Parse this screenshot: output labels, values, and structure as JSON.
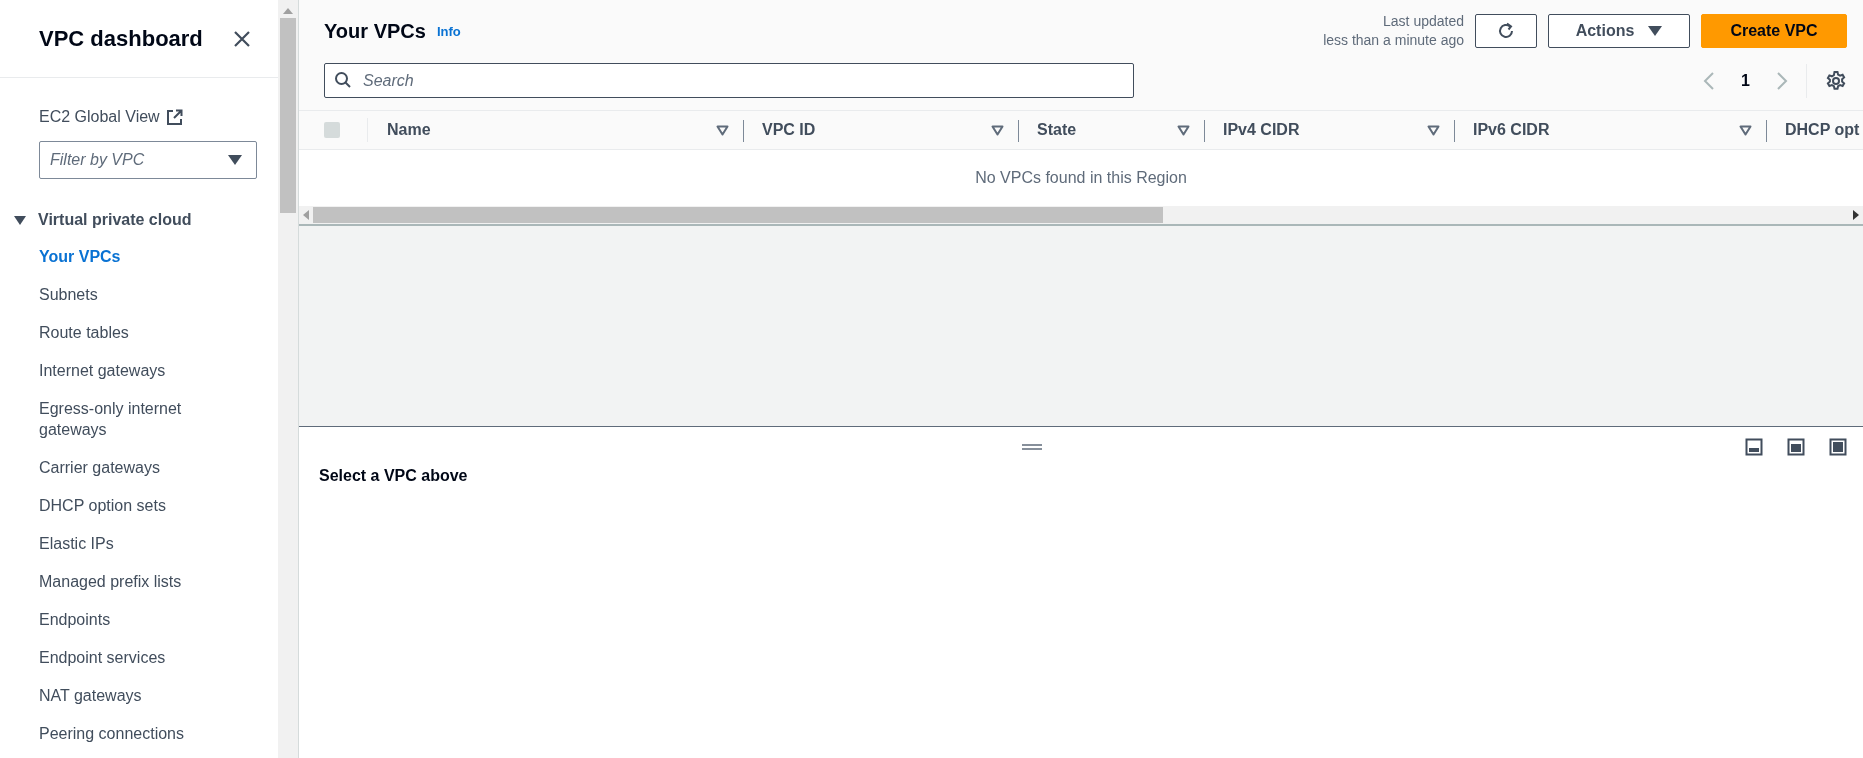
{
  "sidebar": {
    "title": "VPC dashboard",
    "global_view_link": "EC2 Global View",
    "filter": {
      "placeholder": "Filter by VPC"
    },
    "section": {
      "label": "Virtual private cloud",
      "expanded": true,
      "items": [
        {
          "label": "Your VPCs",
          "selected": true
        },
        {
          "label": "Subnets",
          "selected": false
        },
        {
          "label": "Route tables",
          "selected": false
        },
        {
          "label": "Internet gateways",
          "selected": false
        },
        {
          "label": "Egress-only internet gateways",
          "selected": false
        },
        {
          "label": "Carrier gateways",
          "selected": false
        },
        {
          "label": "DHCP option sets",
          "selected": false
        },
        {
          "label": "Elastic IPs",
          "selected": false
        },
        {
          "label": "Managed prefix lists",
          "selected": false
        },
        {
          "label": "Endpoints",
          "selected": false
        },
        {
          "label": "Endpoint services",
          "selected": false
        },
        {
          "label": "NAT gateways",
          "selected": false
        },
        {
          "label": "Peering connections",
          "selected": false
        }
      ]
    }
  },
  "header": {
    "title": "Your VPCs",
    "info": "Info",
    "last_updated": [
      "Last updated",
      "less than a minute ago"
    ],
    "actions": "Actions",
    "create": "Create VPC"
  },
  "search": {
    "placeholder": "Search"
  },
  "pagination": {
    "page": "1"
  },
  "table": {
    "select_all": {
      "checked": false,
      "disabled": true
    },
    "columns": [
      "Name",
      "VPC ID",
      "State",
      "IPv4 CIDR",
      "IPv6 CIDR",
      "DHCP opt"
    ],
    "empty": "No VPCs found in this Region"
  },
  "split_panel": {
    "message": "Select a VPC above"
  }
}
